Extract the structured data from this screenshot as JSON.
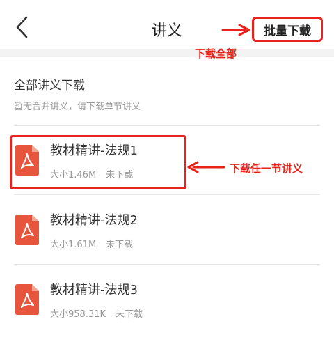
{
  "header": {
    "title": "讲义",
    "batch_download_label": "批量下载",
    "back_icon": "chevron-left-icon"
  },
  "annotations": {
    "download_all": "下载全部",
    "download_single": "下载任一节讲义"
  },
  "all_download": {
    "title": "全部讲义下载",
    "subtitle": "暂无合并讲义，请下载单节讲义"
  },
  "items": [
    {
      "title": "教材精讲-法规1",
      "size": "大小1.46M",
      "status": "未下载",
      "icon": "pdf-icon"
    },
    {
      "title": "教材精讲-法规2",
      "size": "大小1.61M",
      "status": "未下载",
      "icon": "pdf-icon"
    },
    {
      "title": "教材精讲-法规3",
      "size": "大小958.31K",
      "status": "未下载",
      "icon": "pdf-icon"
    }
  ],
  "colors": {
    "annotation_red": "#e8231c",
    "pdf_red": "#e8553d",
    "text_primary": "#333333",
    "text_secondary": "#999999"
  }
}
